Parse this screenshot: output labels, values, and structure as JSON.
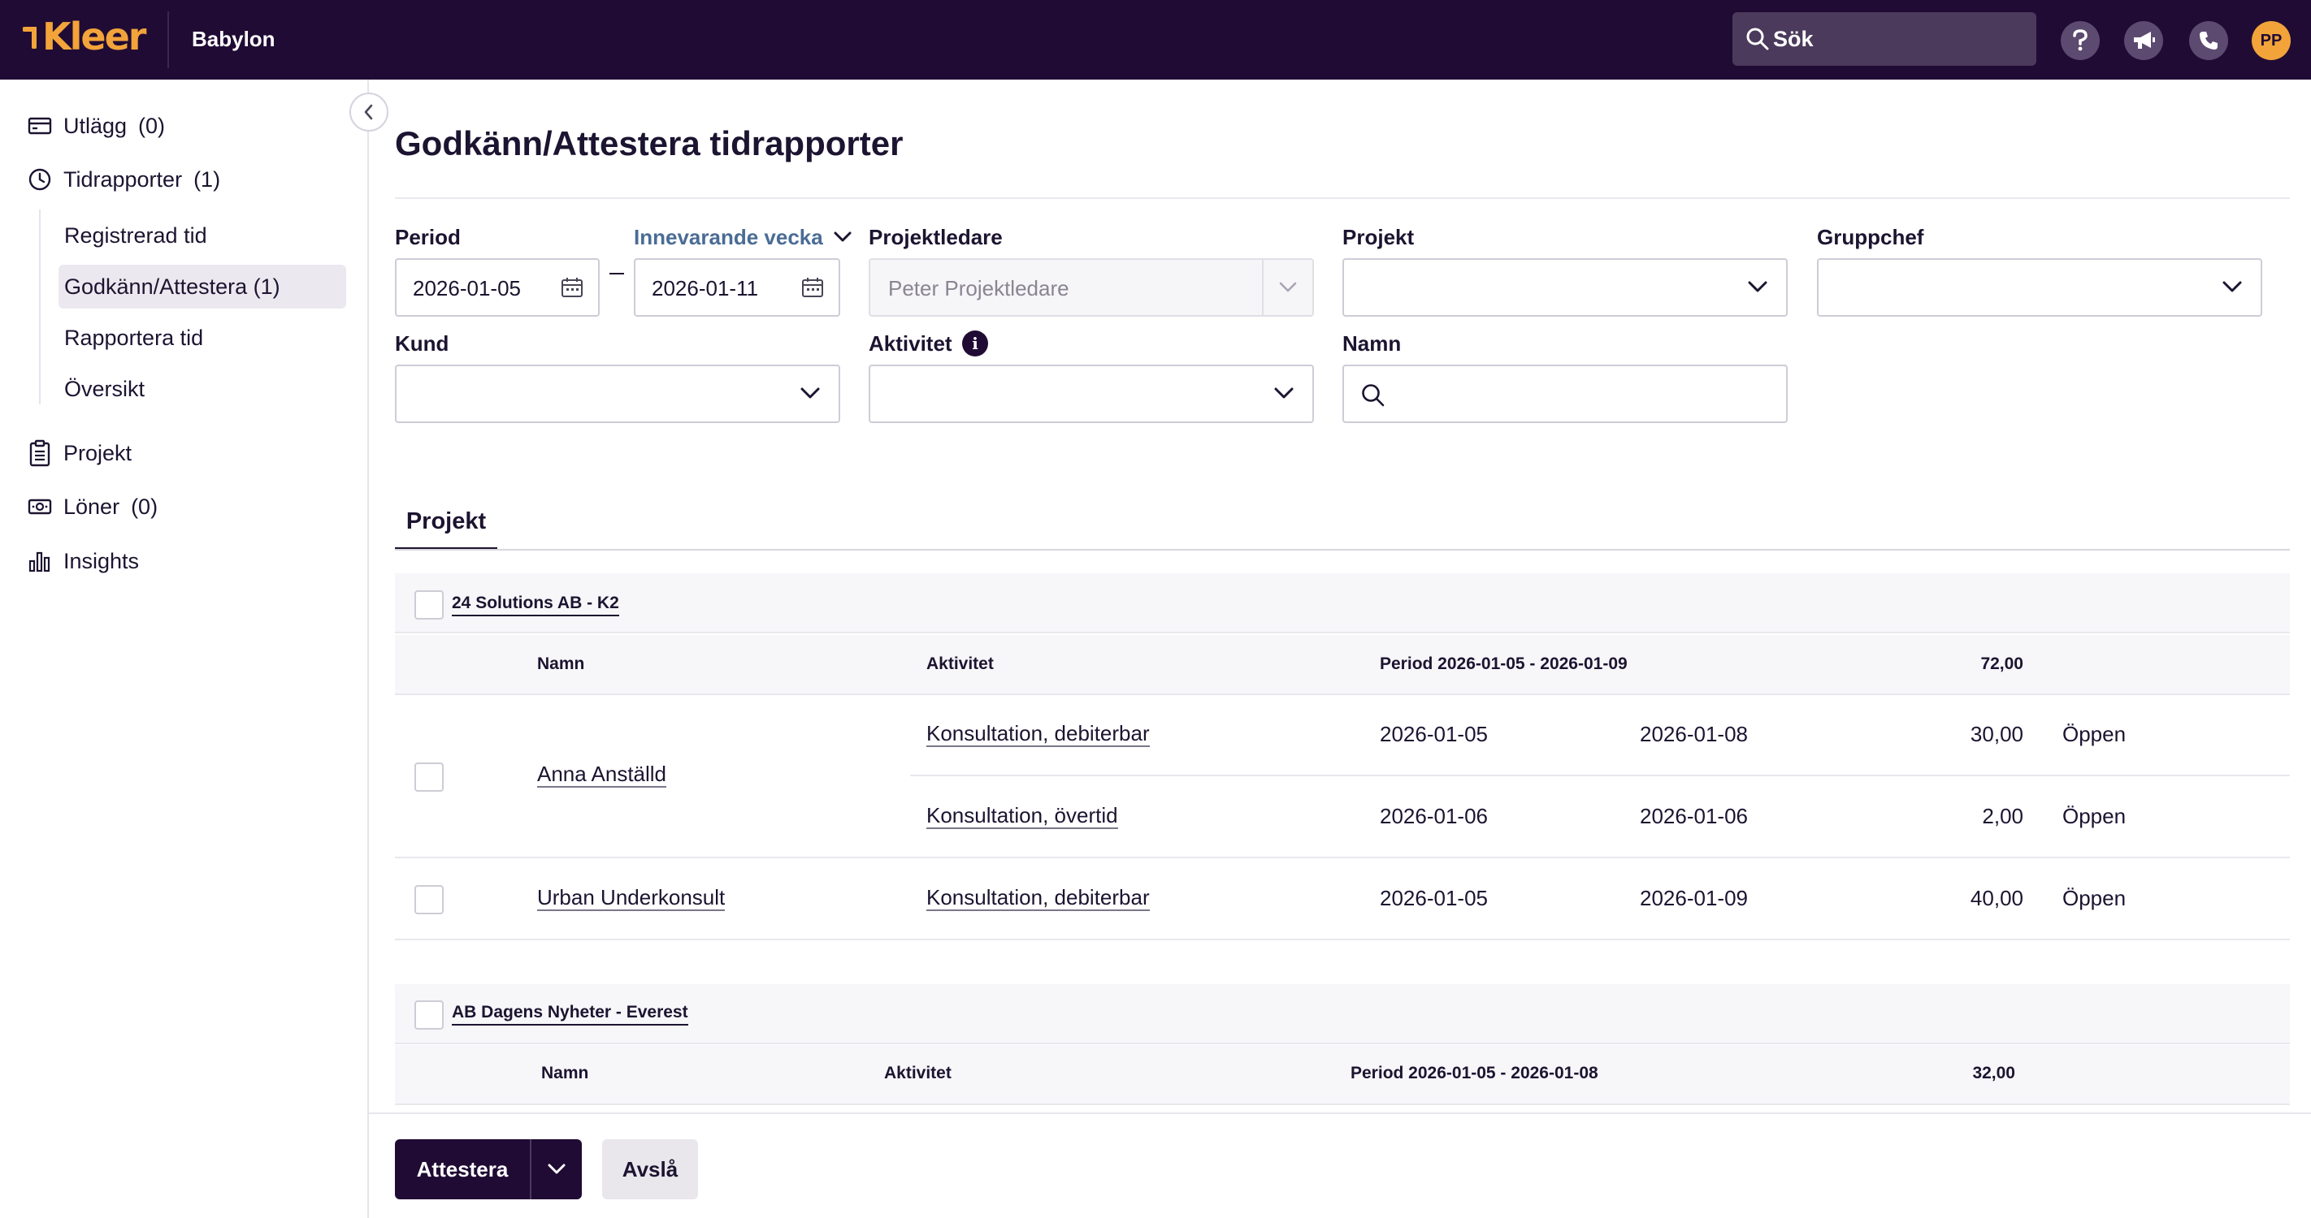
{
  "topbar": {
    "logo_text": "Kleer",
    "company": "Babylon",
    "search_placeholder": "Sök",
    "avatar_initials": "PP",
    "icons": [
      "help-icon",
      "megaphone-icon",
      "phone-icon"
    ],
    "colors": {
      "bar": "#200b34",
      "logo": "#f2a33a"
    }
  },
  "sidebar": {
    "items": [
      {
        "label": "Utlägg",
        "count": "(0)",
        "icon": "card-icon"
      },
      {
        "label": "Tidrapporter",
        "count": "(1)",
        "icon": "clock-icon"
      },
      {
        "label": "Projekt",
        "count": "",
        "icon": "clipboard-icon"
      },
      {
        "label": "Löner",
        "count": "(0)",
        "icon": "money-icon"
      },
      {
        "label": "Insights",
        "count": "",
        "icon": "bar-chart-icon"
      }
    ],
    "subitems": [
      {
        "label": "Registrerad tid",
        "active": false
      },
      {
        "label": "Godkänn/Attestera (1)",
        "active": true
      },
      {
        "label": "Rapportera tid",
        "active": false
      },
      {
        "label": "Översikt",
        "active": false
      }
    ]
  },
  "page": {
    "title": "Godkänn/Attestera tidrapporter"
  },
  "filters": {
    "period_label": "Period",
    "period_from": "2026-01-05",
    "period_to": "2026-01-11",
    "period_preset": "Innevarande vecka",
    "projektledare_label": "Projektledare",
    "projektledare_value": "Peter Projektledare",
    "projekt_label": "Projekt",
    "projekt_value": "",
    "gruppchef_label": "Gruppchef",
    "gruppchef_value": "",
    "kund_label": "Kund",
    "kund_value": "",
    "aktivitet_label": "Aktivitet",
    "aktivitet_value": "",
    "namn_label": "Namn",
    "namn_value": "",
    "info_glyph": "i"
  },
  "tabs": [
    {
      "label": "Projekt",
      "active": true
    }
  ],
  "groups": [
    {
      "title": "24 Solutions AB - K2",
      "headers": {
        "namn": "Namn",
        "aktivitet": "Aktivitet",
        "period": "Period 2026-01-05 - 2026-01-09",
        "total": "72,00"
      },
      "people": [
        {
          "name": "Anna Anställd",
          "rows": [
            {
              "aktivitet": "Konsultation, debiterbar",
              "from": "2026-01-05",
              "to": "2026-01-08",
              "hours": "30,00",
              "status": "Öppen"
            },
            {
              "aktivitet": "Konsultation, övertid",
              "from": "2026-01-06",
              "to": "2026-01-06",
              "hours": "2,00",
              "status": "Öppen"
            }
          ]
        },
        {
          "name": "Urban Underkonsult",
          "rows": [
            {
              "aktivitet": "Konsultation, debiterbar",
              "from": "2026-01-05",
              "to": "2026-01-09",
              "hours": "40,00",
              "status": "Öppen"
            }
          ]
        }
      ]
    },
    {
      "title": "AB Dagens Nyheter - Everest",
      "headers": {
        "namn": "Namn",
        "aktivitet": "Aktivitet",
        "period": "Period 2026-01-05 - 2026-01-08",
        "total": "32,00"
      },
      "people": []
    }
  ],
  "footer": {
    "primary": "Attestera",
    "secondary": "Avslå"
  }
}
